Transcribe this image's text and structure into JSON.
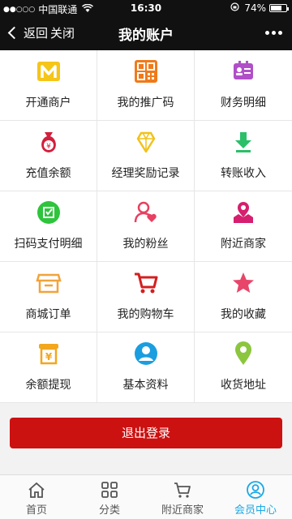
{
  "status": {
    "carrier": "中国联通",
    "time": "16:30",
    "battery": "74%",
    "battery_level": 0.74
  },
  "nav": {
    "back_label": "返回",
    "close_label": "关闭",
    "title": "我的账户"
  },
  "grid": [
    {
      "label": "开通商户",
      "icon": "m-logo-icon",
      "color": "#f5c518"
    },
    {
      "label": "我的推广码",
      "icon": "qr-code-icon",
      "color": "#f07a1a"
    },
    {
      "label": "财务明细",
      "icon": "id-card-icon",
      "color": "#b04fc8"
    },
    {
      "label": "充值余额",
      "icon": "money-bag-icon",
      "color": "#d21f3c"
    },
    {
      "label": "经理奖励记录",
      "icon": "diamond-icon",
      "color": "#f2c21b"
    },
    {
      "label": "转账收入",
      "icon": "download-arrow-icon",
      "color": "#2bbf6a"
    },
    {
      "label": "扫码支付明细",
      "icon": "scan-pay-icon",
      "color": "#2ec43c"
    },
    {
      "label": "我的粉丝",
      "icon": "fans-icon",
      "color": "#e84060"
    },
    {
      "label": "附近商家",
      "icon": "map-pin-icon",
      "color": "#d61f6e"
    },
    {
      "label": "商城订单",
      "icon": "store-icon",
      "color": "#f2a33a"
    },
    {
      "label": "我的购物车",
      "icon": "cart-icon",
      "color": "#d41f1f"
    },
    {
      "label": "我的收藏",
      "icon": "star-icon",
      "color": "#e8456a"
    },
    {
      "label": "余额提现",
      "icon": "yuan-withdraw-icon",
      "color": "#f2a71e"
    },
    {
      "label": "基本资料",
      "icon": "profile-icon",
      "color": "#1a9ee0"
    },
    {
      "label": "收货地址",
      "icon": "location-icon",
      "color": "#8cc63f"
    }
  ],
  "logout_label": "退出登录",
  "tabs": [
    {
      "label": "首页",
      "icon": "home-icon"
    },
    {
      "label": "分类",
      "icon": "category-icon"
    },
    {
      "label": "附近商家",
      "icon": "cart-icon"
    },
    {
      "label": "会员中心",
      "icon": "member-icon",
      "active": true
    }
  ],
  "colors": {
    "header_bg": "#111111",
    "logout_bg": "#cc1111",
    "tab_active": "#19a9e6"
  }
}
